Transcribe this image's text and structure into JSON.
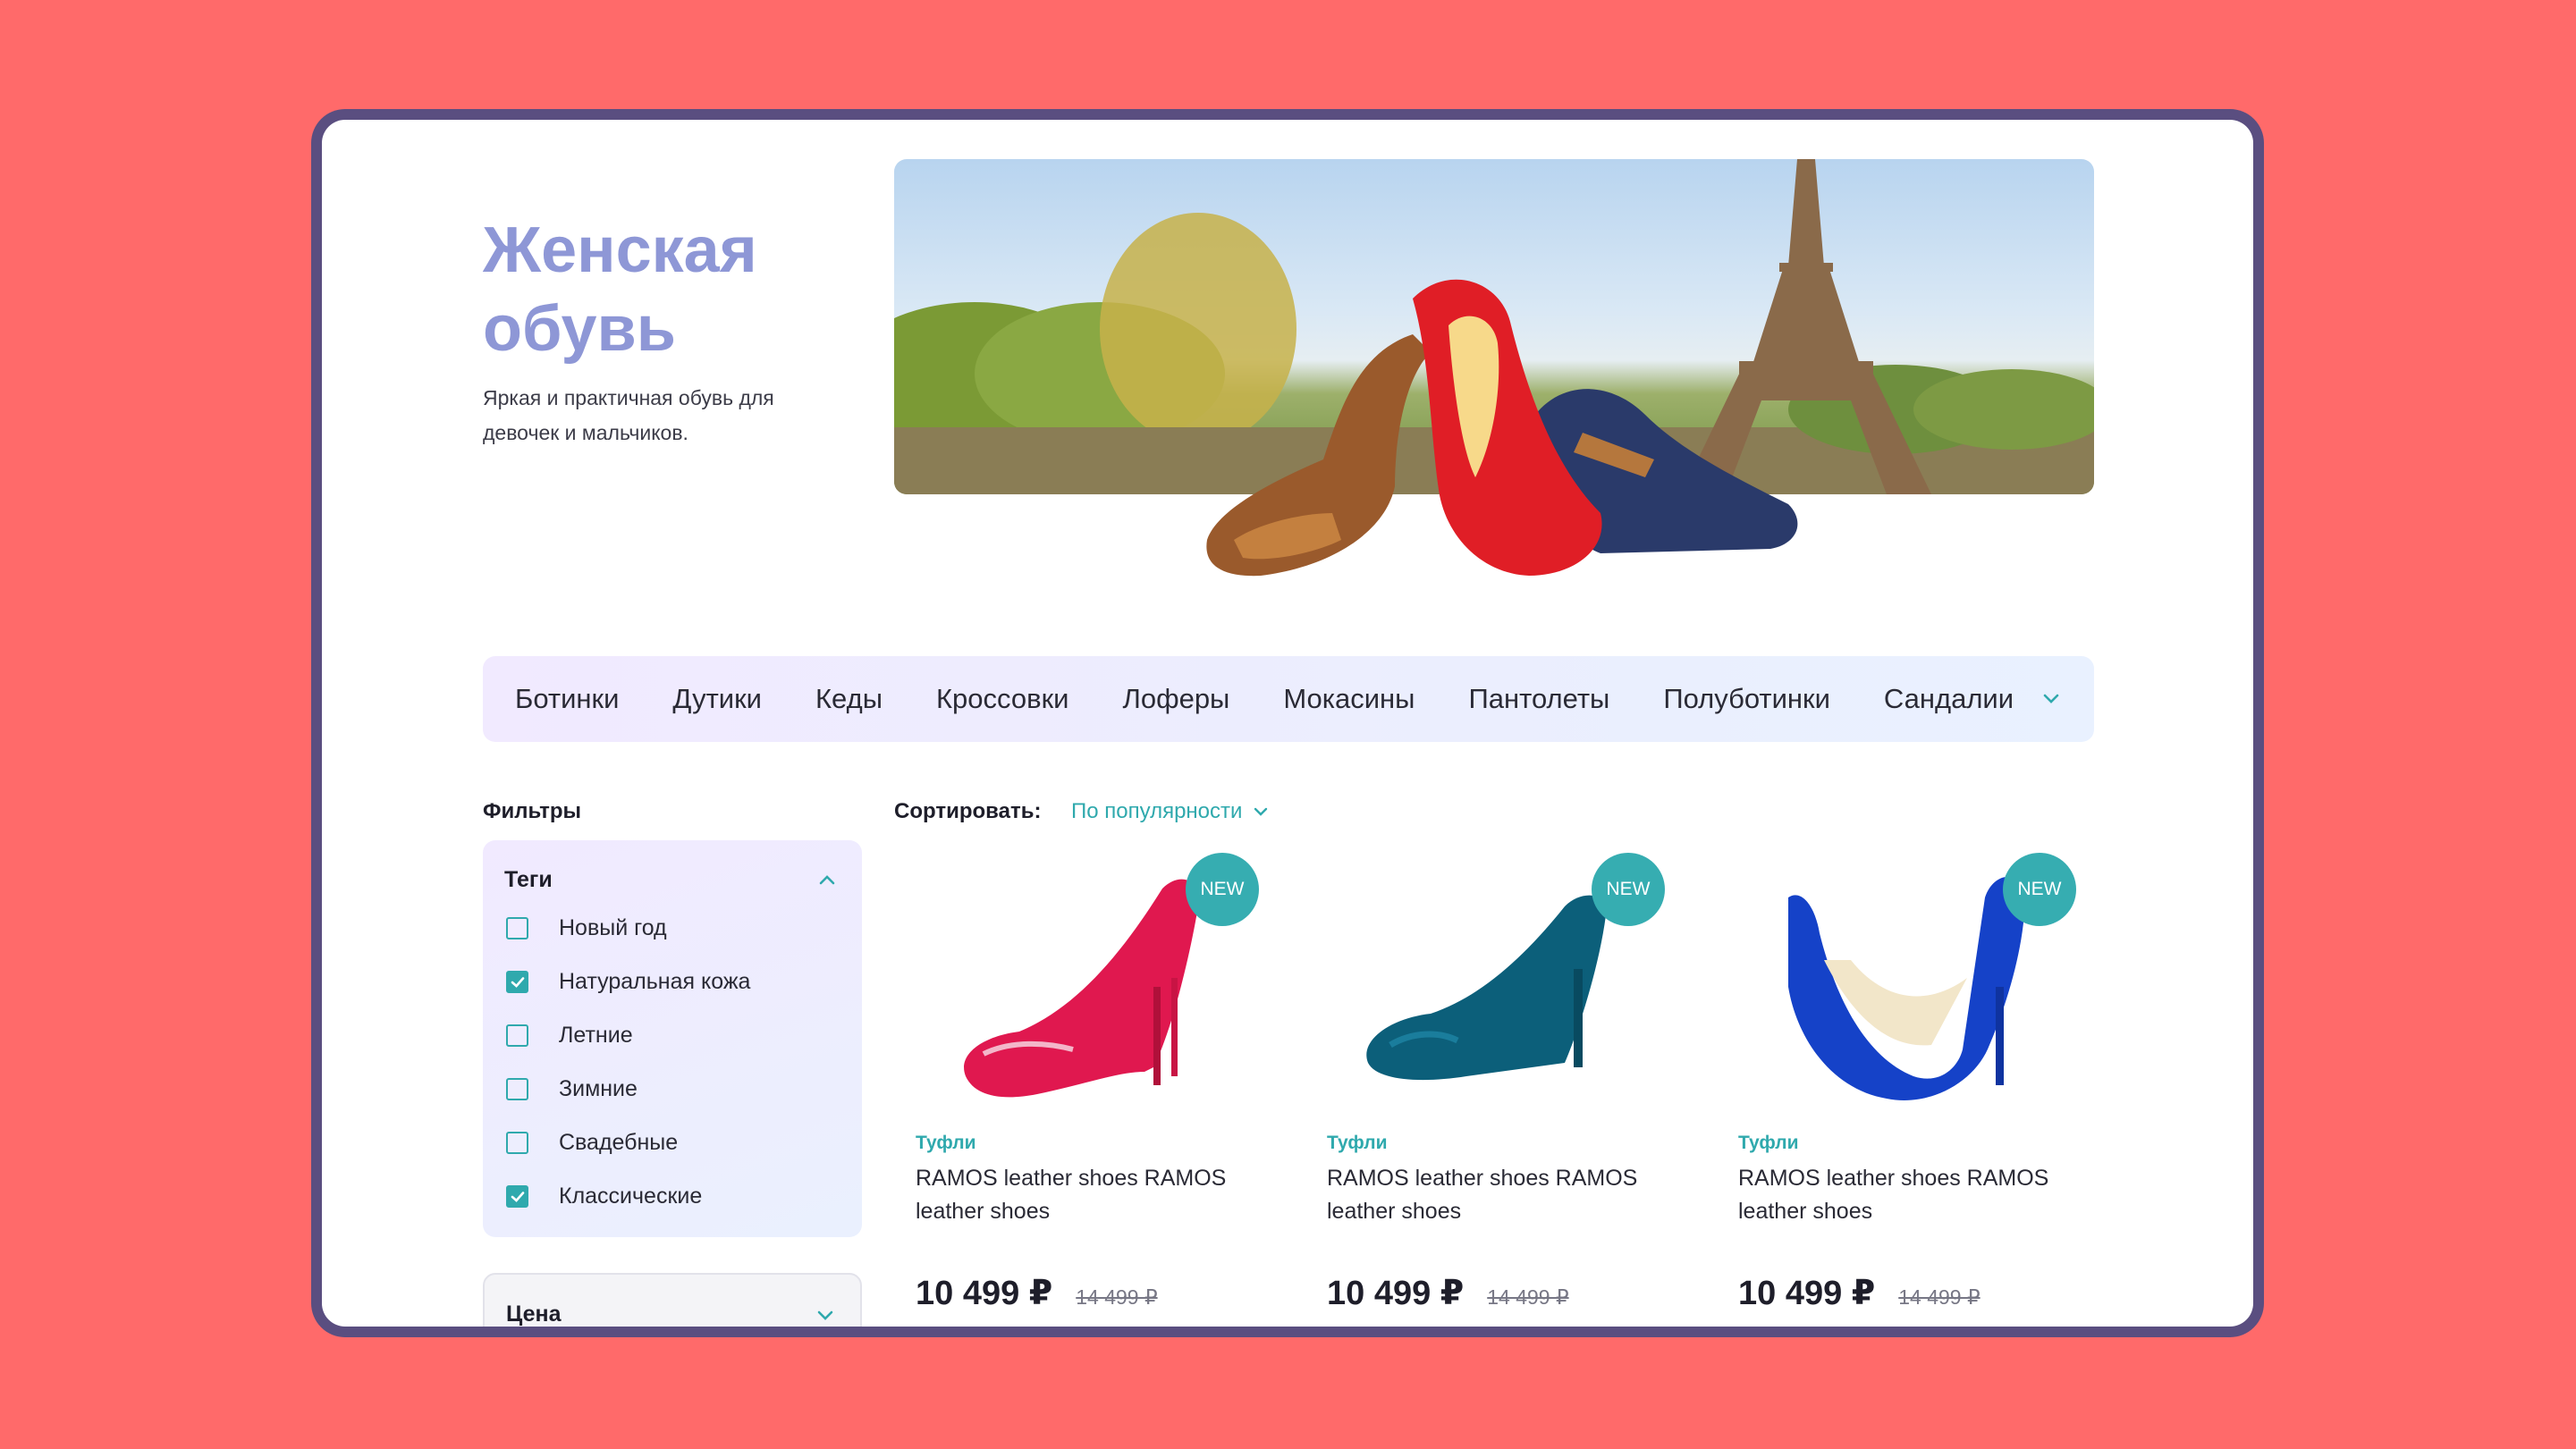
{
  "hero": {
    "title": "Женская обувь",
    "subtitle": "Яркая и практичная обувь для девочек и мальчиков."
  },
  "categories": [
    "Ботинки",
    "Дутики",
    "Кеды",
    "Кроссовки",
    "Лоферы",
    "Мокасины",
    "Пантолеты",
    "Полуботинки",
    "Сандалии"
  ],
  "filters": {
    "label": "Фильтры",
    "tags": {
      "title": "Теги",
      "items": [
        {
          "label": "Новый год",
          "checked": false
        },
        {
          "label": "Натуральная кожа",
          "checked": true
        },
        {
          "label": "Летние",
          "checked": false
        },
        {
          "label": "Зимние",
          "checked": false
        },
        {
          "label": "Свадебные",
          "checked": false
        },
        {
          "label": "Классические",
          "checked": true
        }
      ]
    },
    "price": {
      "title": "Цена"
    }
  },
  "sort": {
    "label": "Сортировать:",
    "value": "По популярности"
  },
  "products": [
    {
      "badge": "NEW",
      "category": "Туфли",
      "name": "RAMOS leather shoes RAMOS leather shoes",
      "price": "10 499 ₽",
      "old_price": "14 499 ₽",
      "color": "#e0184f"
    },
    {
      "badge": "NEW",
      "category": "Туфли",
      "name": "RAMOS leather shoes RAMOS leather shoes",
      "price": "10 499 ₽",
      "old_price": "14 499 ₽",
      "color": "#0c5f7a"
    },
    {
      "badge": "NEW",
      "category": "Туфли",
      "name": "RAMOS leather shoes RAMOS leather shoes",
      "price": "10 499 ₽",
      "old_price": "14 499 ₽",
      "color": "#1542c8"
    }
  ],
  "colors": {
    "accent": "#2fa9ad",
    "title": "#8e97d6",
    "background": "#ff6a6a",
    "frame": "#5a4e80"
  }
}
